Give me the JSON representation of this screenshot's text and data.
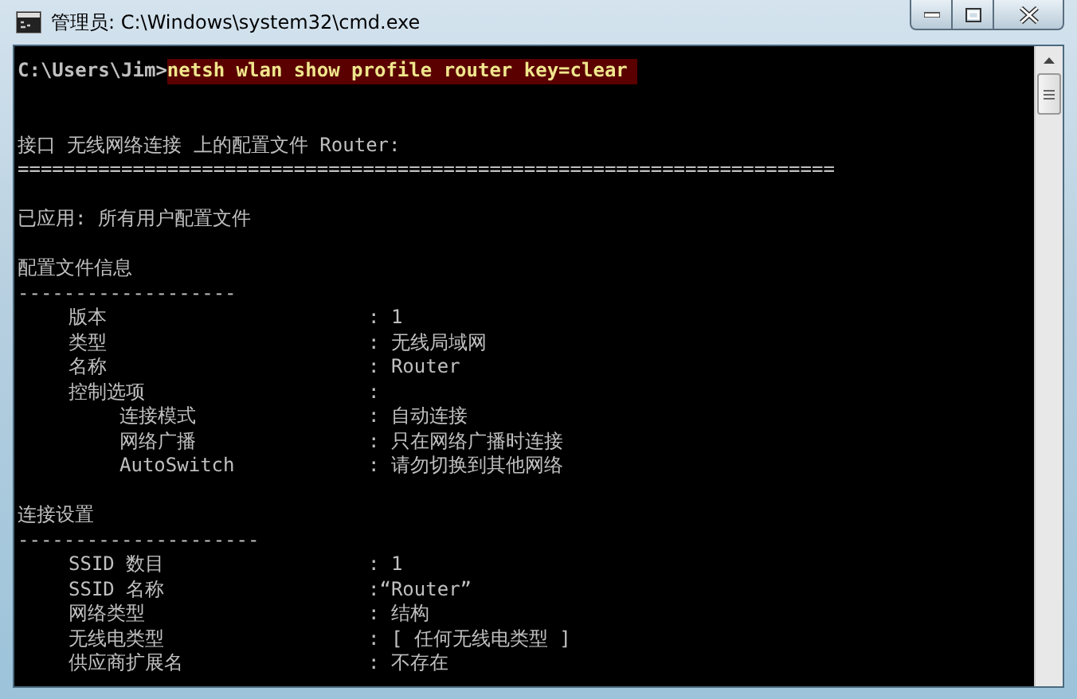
{
  "window": {
    "title": "管理员: C:\\Windows\\system32\\cmd.exe"
  },
  "console": {
    "prompt": "C:\\Users\\Jim>",
    "command": "netsh wlan show profile router key=clear",
    "lines": [
      {
        "kind": "blank"
      },
      {
        "kind": "text",
        "text": "接口 无线网络连接 上的配置文件 Router:"
      },
      {
        "kind": "rule",
        "text": "======================================================================="
      },
      {
        "kind": "blank"
      },
      {
        "kind": "text",
        "text": "已应用: 所有用户配置文件"
      },
      {
        "kind": "blank"
      },
      {
        "kind": "text",
        "text": "配置文件信息"
      },
      {
        "kind": "rule",
        "text": "-------------------"
      },
      {
        "kind": "property",
        "label": "版本",
        "value": ": 1"
      },
      {
        "kind": "property",
        "label": "类型",
        "value": ": 无线局域网"
      },
      {
        "kind": "property",
        "label": "名称",
        "value": ": Router"
      },
      {
        "kind": "property",
        "label": "控制选项",
        "value": ":",
        "children": [
          {
            "kind": "property",
            "label": "连接模式",
            "value": ": 自动连接"
          },
          {
            "kind": "property",
            "label": "网络广播",
            "value": ": 只在网络广播时连接"
          },
          {
            "kind": "property",
            "label": "AutoSwitch",
            "value": ": 请勿切换到其他网络"
          }
        ]
      },
      {
        "kind": "blank"
      },
      {
        "kind": "text",
        "text": "连接设置"
      },
      {
        "kind": "rule",
        "text": "---------------------"
      },
      {
        "kind": "property",
        "label": "SSID 数目",
        "value": ": 1"
      },
      {
        "kind": "property",
        "label": "SSID 名称",
        "value": ":“Router”"
      },
      {
        "kind": "property",
        "label": "网络类型",
        "value": ": 结构"
      },
      {
        "kind": "property",
        "label": "无线电类型",
        "value": ": [ 任何无线电类型 ]"
      },
      {
        "kind": "property",
        "label": "供应商扩展名",
        "value": ": 不存在"
      }
    ]
  }
}
